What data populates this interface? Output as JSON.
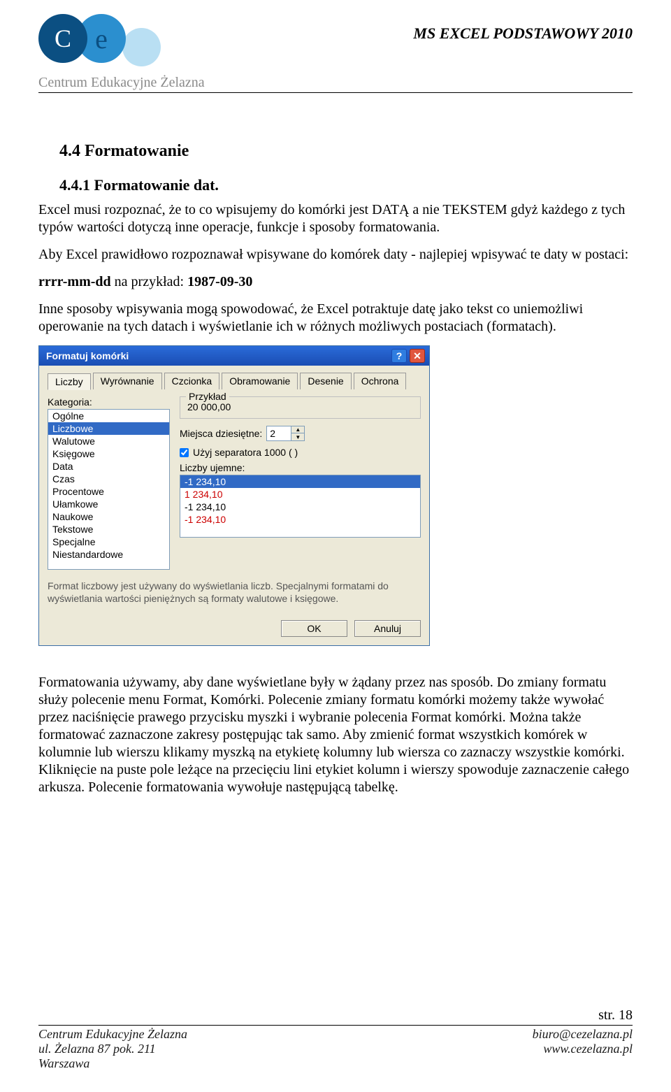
{
  "header": {
    "doc_title": "MS EXCEL PODSTAWOWY 2010",
    "logo_letter_c": "C",
    "logo_letter_e": "e",
    "logo_caption": "Centrum Edukacyjne Żelazna"
  },
  "s1": {
    "heading": "4.4  Formatowanie",
    "subheading": "4.4.1  Formatowanie dat.",
    "p1": "Excel musi rozpoznać, że to co wpisujemy do komórki jest DATĄ a nie TEKSTEM gdyż każdego z tych typów wartości dotyczą inne operacje, funkcje i sposoby formatowania.",
    "p2": "Aby Excel prawidłowo rozpoznawał wpisywane do komórek daty - najlepiej wpisywać te daty w postaci:",
    "p3_a": "rrrr-mm-dd",
    "p3_b": " na przykład: ",
    "p3_c": "1987-09-30",
    "p4": "Inne sposoby wpisywania mogą spowodować, że Excel potraktuje datę jako tekst co uniemożliwi operowanie na tych datach i wyświetlanie ich w różnych możliwych postaciach (formatach)."
  },
  "dialog": {
    "title": "Formatuj komórki",
    "help_char": "?",
    "close_char": "✕",
    "tabs": [
      "Liczby",
      "Wyrównanie",
      "Czcionka",
      "Obramowanie",
      "Desenie",
      "Ochrona"
    ],
    "category_label": "Kategoria:",
    "categories": [
      "Ogólne",
      "Liczbowe",
      "Walutowe",
      "Księgowe",
      "Data",
      "Czas",
      "Procentowe",
      "Ułamkowe",
      "Naukowe",
      "Tekstowe",
      "Specjalne",
      "Niestandardowe"
    ],
    "category_selected": 1,
    "sample_label": "Przykład",
    "sample_value": "20 000,00",
    "decimals_label": "Miejsca dziesiętne:",
    "decimals_value": "2",
    "separator_label": "Użyj separatora 1000 ( )",
    "separator_checked": true,
    "negative_label": "Liczby ujemne:",
    "negatives": [
      {
        "text": "-1 234,10",
        "selected": true,
        "red": false
      },
      {
        "text": "1 234,10",
        "selected": false,
        "red": true
      },
      {
        "text": "-1 234,10",
        "selected": false,
        "red": false
      },
      {
        "text": "-1 234,10",
        "selected": false,
        "red": true
      }
    ],
    "description": "Format liczbowy jest używany do wyświetlania liczb. Specjalnymi formatami do wyświetlania wartości pieniężnych są formaty walutowe i księgowe.",
    "ok": "OK",
    "cancel": "Anuluj"
  },
  "s2": {
    "p1": "Formatowania używamy, aby dane wyświetlane były w żądany przez nas sposób. Do zmiany formatu służy polecenie menu Format, Komórki. Polecenie zmiany formatu komórki możemy także wywołać przez naciśnięcie prawego przycisku myszki i wybranie polecenia Format komórki. Można także formatować zaznaczone zakresy postępując tak samo. Aby zmienić format wszystkich komórek w kolumnie lub wierszu klikamy myszką na etykietę kolumny lub wiersza co zaznaczy wszystkie komórki. Kliknięcie na puste pole leżące na przecięciu lini etykiet kolumn i wierszy spowoduje zaznaczenie całego arkusza. Polecenie formatowania wywołuje następującą tabelkę."
  },
  "footer": {
    "page": "str. 18",
    "org": "Centrum Edukacyjne Żelazna",
    "address": "ul. Żelazna 87 pok. 211",
    "city": "Warszawa",
    "email": "biuro@cezelazna.pl",
    "web": "www.cezelazna.pl"
  }
}
